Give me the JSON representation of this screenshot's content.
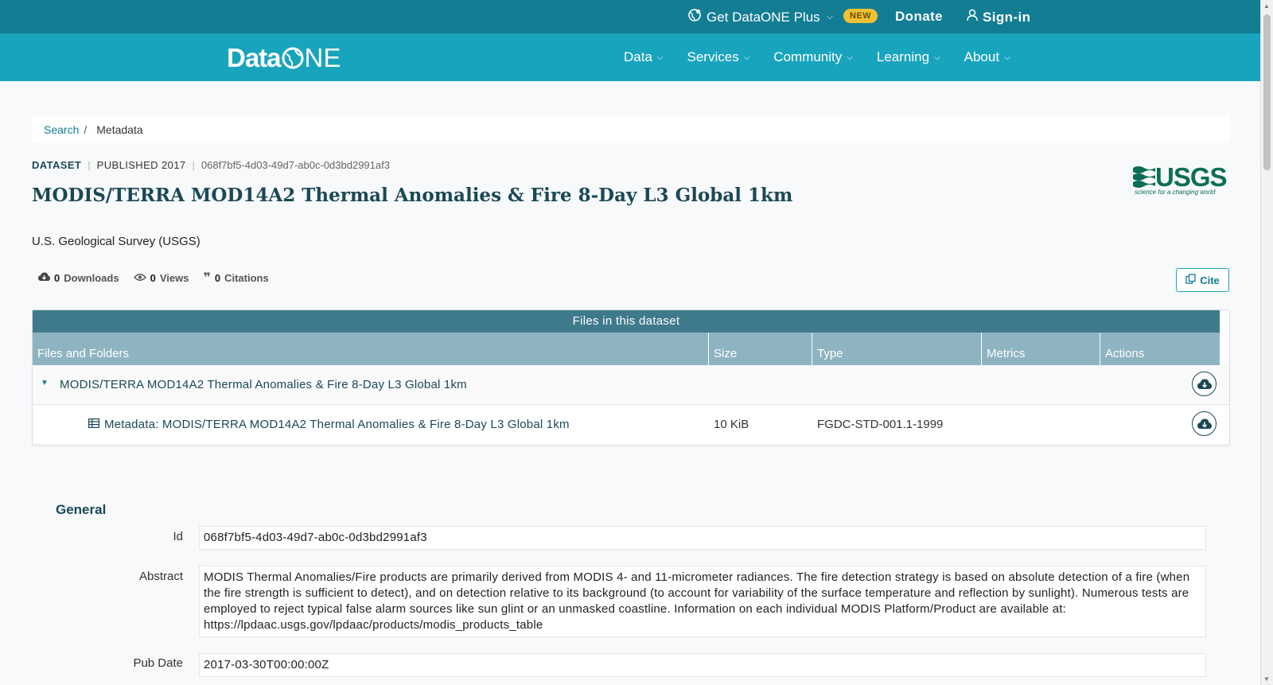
{
  "topbar": {
    "plus_label": "Get DataONE Plus",
    "new_badge": "NEW",
    "donate": "Donate",
    "signin": "Sign-in"
  },
  "nav": {
    "logo_prefix": "Data",
    "logo_suffix": "NE",
    "items": [
      "Data",
      "Services",
      "Community",
      "Learning",
      "About"
    ]
  },
  "breadcrumb": {
    "search": "Search",
    "separator": "/",
    "current": "Metadata"
  },
  "dataset": {
    "type": "DATASET",
    "published": "PUBLISHED 2017",
    "pid": "068f7bf5-4d03-49d7-ab0c-0d3bd2991af3",
    "title": "MODIS/TERRA MOD14A2 Thermal Anomalies & Fire 8-Day L3 Global 1km",
    "organization": "U.S. Geological Survey (USGS)",
    "logo_text": "USGS",
    "logo_tagline": "science for a changing world"
  },
  "stats": {
    "downloads_count": "0",
    "downloads_label": "Downloads",
    "views_count": "0",
    "views_label": "Views",
    "citations_count": "0",
    "citations_label": "Citations",
    "cite_button": "Cite"
  },
  "files": {
    "caption": "Files in this dataset",
    "columns": [
      "Files and Folders",
      "Size",
      "Type",
      "Metrics",
      "Actions"
    ],
    "folder": {
      "name": "MODIS/TERRA MOD14A2 Thermal Anomalies & Fire 8-Day L3 Global 1km"
    },
    "rows": [
      {
        "name": "Metadata: MODIS/TERRA MOD14A2 Thermal Anomalies & Fire 8-Day L3 Global 1km",
        "size": "10 KiB",
        "type": "FGDC-STD-001.1-1999"
      }
    ]
  },
  "general": {
    "title": "General",
    "id_label": "Id",
    "id_value": "068f7bf5-4d03-49d7-ab0c-0d3bd2991af3",
    "abstract_label": "Abstract",
    "abstract_value": "MODIS Thermal Anomalies/Fire products are primarily derived from MODIS 4- and 11-micrometer radiances. The fire detection strategy is based on absolute detection of a fire (when the fire strength is sufficient to detect), and on detection relative to its background (to account for variability of the surface temperature and reflection by sunlight). Numerous tests are employed to reject typical false alarm sources like sun glint or an unmasked coastline. Information on each individual MODIS Platform/Product are available at: https://lpdaac.usgs.gov/lpdaac/products/modis_products_table",
    "pubdate_label": "Pub Date",
    "pubdate_value": "2017-03-30T00:00:00Z"
  },
  "colors": {
    "topbar": "#127d93",
    "navbar": "#19a4bd",
    "title": "#1b4856",
    "table_caption": "#3f7a8c",
    "table_header": "#8fb4c1",
    "badge": "#f0c233"
  }
}
